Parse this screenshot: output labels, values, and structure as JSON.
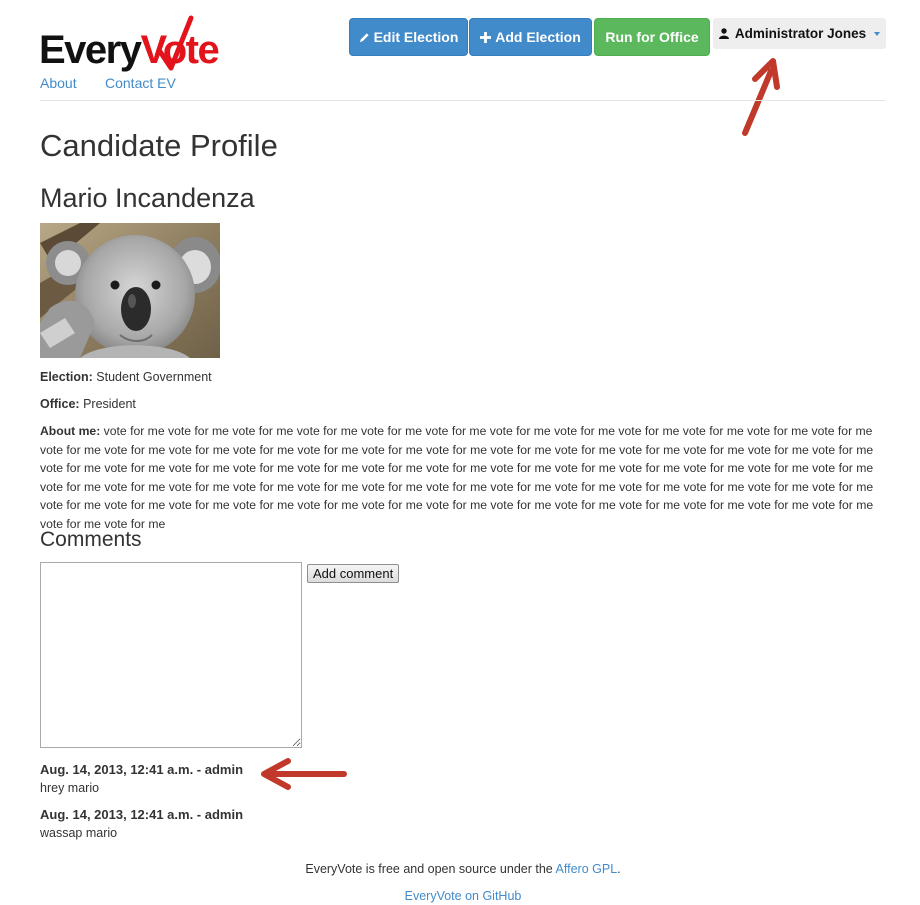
{
  "logo": {
    "every": "Every",
    "vote": "Vote",
    "check_color": "#e3131b"
  },
  "nav": {
    "about": "About",
    "contact": "Contact EV"
  },
  "toolbar": {
    "edit_election": "Edit Election",
    "add_election": "Add Election",
    "run_for_office": "Run for Office",
    "user_menu": "Administrator Jones"
  },
  "colors": {
    "primary": "#428bca",
    "success": "#5cb85c",
    "annotation_arrow": "#c0392b"
  },
  "page": {
    "title": "Candidate Profile"
  },
  "candidate": {
    "name": "Mario Incandenza",
    "election_label": "Election:",
    "election": "Student Government",
    "office_label": "Office:",
    "office": "President",
    "about_label": "About me:",
    "about": "vote for me vote for me vote for me vote for me vote for me vote for me vote for me vote for me vote for me vote for me vote for me vote for me vote for me vote for me vote for me vote for me vote for me vote for me vote for me vote for me vote for me vote for me vote for me vote for me vote for me vote for me vote for me vote for me vote for me vote for me vote for me vote for me vote for me vote for me vote for me vote for me vote for me vote for me vote for me vote for me vote for me vote for me vote for me vote for me vote for me vote for me vote for me vote for me vote for me vote for me vote for me vote for me vote for me vote for me vote for me vote for me vote for me vote for me vote for me vote for me vote for me vote for me vote for me vote for me vote for me vote for me"
  },
  "comments": {
    "heading": "Comments",
    "add_label": "Add comment",
    "items": [
      {
        "meta": "Aug. 14, 2013, 12:41 a.m. - admin",
        "text": "hrey mario"
      },
      {
        "meta": "Aug. 14, 2013, 12:41 a.m. - admin",
        "text": "wassap mario"
      }
    ]
  },
  "footer": {
    "prefix": "EveryVote is free and open source under the ",
    "license_link": "Affero GPL",
    "suffix": ".",
    "github_link": "EveryVote on GitHub"
  }
}
